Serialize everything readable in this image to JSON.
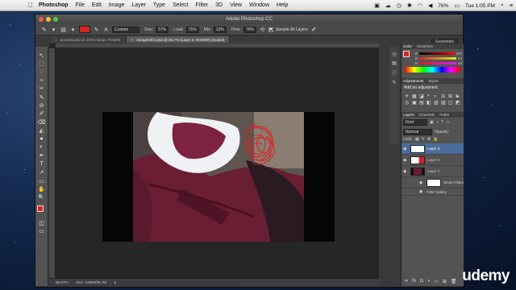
{
  "menubar": {
    "apple": "",
    "app_name": "Photoshop",
    "items": [
      "File",
      "Edit",
      "Image",
      "Layer",
      "Type",
      "Select",
      "Filter",
      "3D",
      "View",
      "Window",
      "Help"
    ],
    "battery": "76%",
    "clock": "Tue 1:05 PM"
  },
  "window": {
    "title": "Adobe Photoshop CC",
    "workspace": "Essentials",
    "traffic_colors": [
      "#ee5c55",
      "#f6bd3f",
      "#5fc73e"
    ]
  },
  "options": {
    "mode_value": "Custom",
    "size_label": "Size:",
    "size_value": "57%",
    "load_label": "Load:",
    "load_value": "75%",
    "mix_label": "Mix:",
    "mix_value": "13%",
    "flow_label": "Flow:",
    "flow_value": "76%",
    "sample_all": "Sample All Layers"
  },
  "doc_tabs": [
    {
      "label": "gondola.psd @ 100% (large, RGB/8)",
      "active": false
    },
    {
      "label": "mirayen001.psd @ 66.7% (Layer 3, RGB/8#) (scaled)",
      "active": true
    }
  ],
  "tools": [
    "↖",
    "⬚",
    "◌",
    "✧",
    "✂",
    "✎",
    "⊘",
    "✐",
    "⌫",
    "◭",
    "●",
    "◐",
    "✒",
    "T",
    "↗",
    "▭",
    "✋",
    "🔍"
  ],
  "status": {
    "zoom": "66.67%",
    "doc": "Doc: 3.96M/25.7M"
  },
  "color_panel": {
    "tabs": [
      "Color",
      "Swatches"
    ],
    "rows": [
      {
        "label": "R",
        "value": "227"
      },
      {
        "label": "G",
        "value": "44"
      },
      {
        "label": "B",
        "value": "44"
      }
    ]
  },
  "adjustments_panel": {
    "tabs": [
      "Adjustments",
      "Styles"
    ],
    "heading": "Add an adjustment",
    "icons": [
      "☀",
      "▦",
      "◪",
      "◑",
      "▿",
      "⚖",
      "⊞",
      "☯",
      "◎",
      "▣",
      "▤",
      "◧",
      "▥",
      "▧",
      "◫",
      "◩"
    ]
  },
  "layers_panel": {
    "tabs": [
      "Layers",
      "Channels",
      "Paths"
    ],
    "kind": "Kind",
    "blend": "Normal",
    "opacity_label": "Opacity:",
    "lock_label": "Lock:",
    "layers": [
      {
        "name": "Layer 3",
        "selected": true
      },
      {
        "name": "Layer 2",
        "selected": false
      },
      {
        "name": "Layer 1",
        "selected": false
      }
    ],
    "smart_filters": "Smart Filters",
    "filter_gallery": "Filter Gallery"
  },
  "watermark": "udemy"
}
